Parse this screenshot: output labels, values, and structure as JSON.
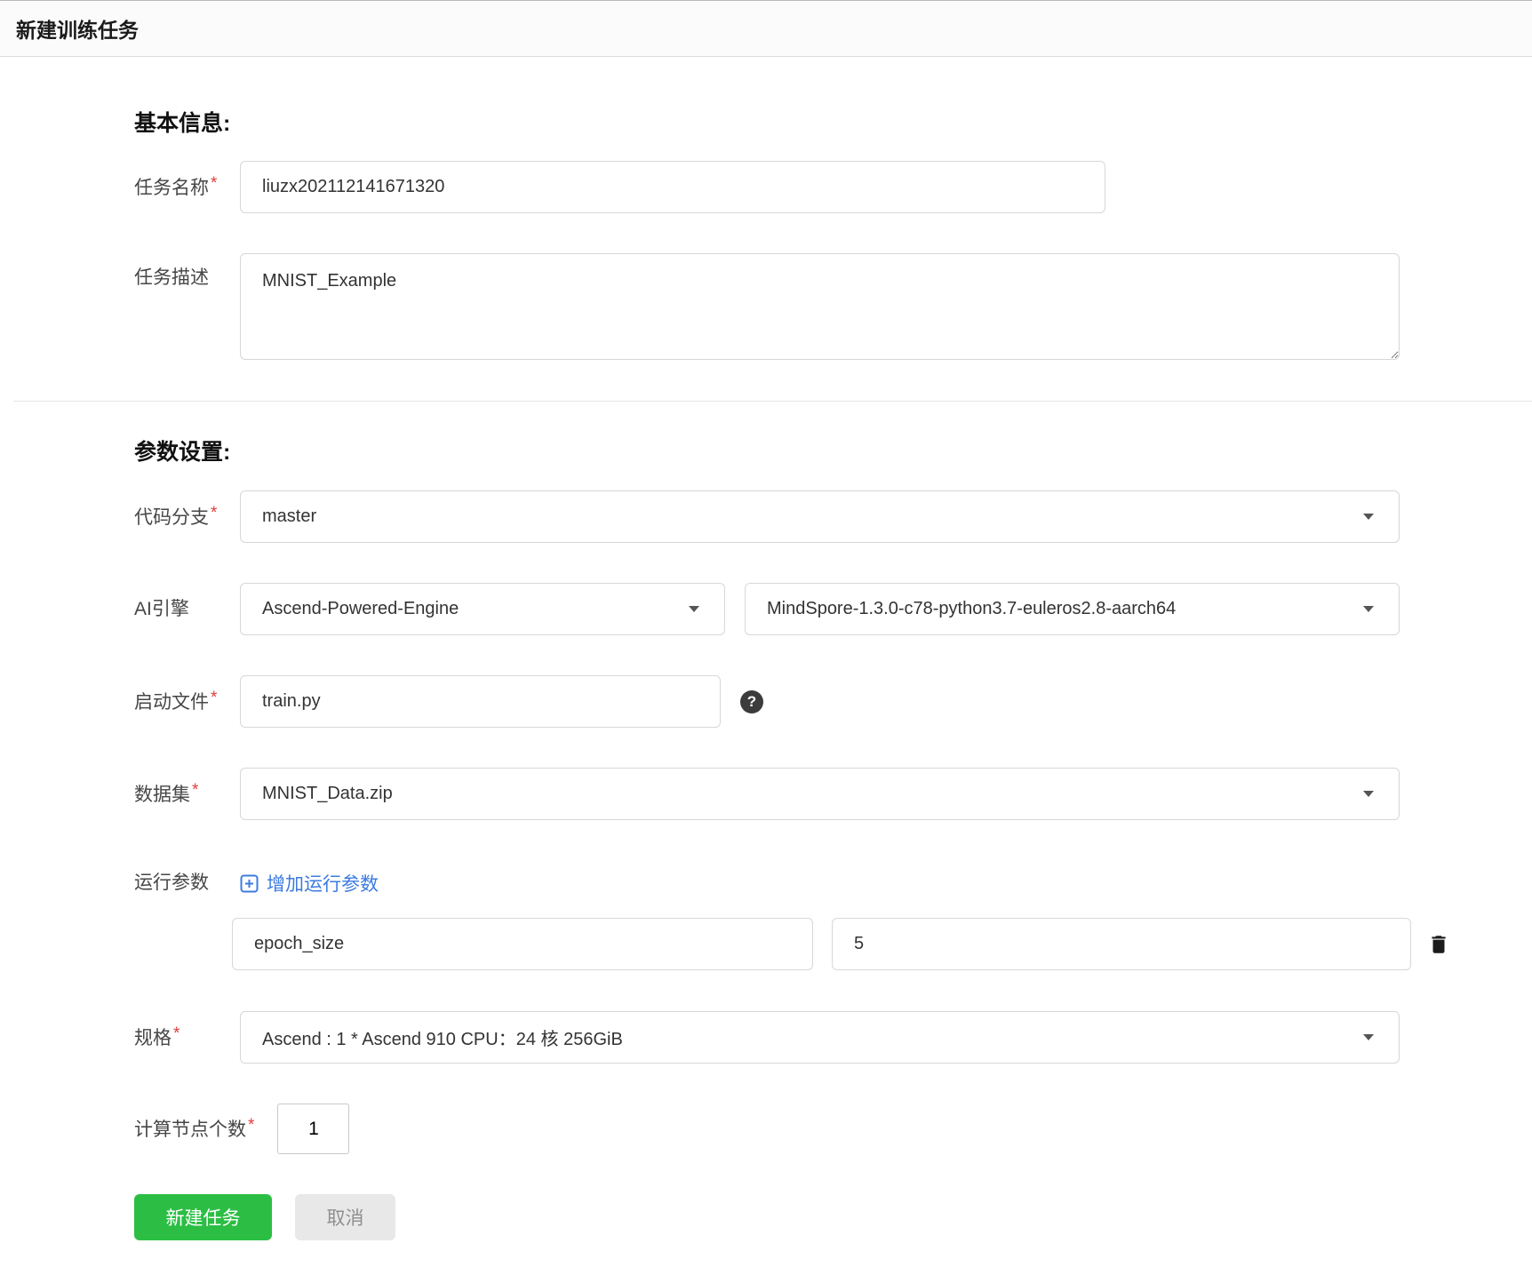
{
  "window": {
    "title": "新建训练任务"
  },
  "sections": {
    "basic_heading": "基本信息:",
    "params_heading": "参数设置:"
  },
  "required_marker": "*",
  "fields": {
    "task_name": {
      "label": "任务名称",
      "value": "liuzx202112141671320"
    },
    "task_desc": {
      "label": "任务描述",
      "value": "MNIST_Example"
    },
    "code_branch": {
      "label": "代码分支",
      "selected": "master"
    },
    "ai_engine": {
      "label": "AI引擎",
      "engine_selected": "Ascend-Powered-Engine",
      "version_selected": "MindSpore-1.3.0-c78-python3.7-euleros2.8-aarch64"
    },
    "boot_file": {
      "label": "启动文件",
      "value": "train.py"
    },
    "dataset": {
      "label": "数据集",
      "selected": "MNIST_Data.zip"
    },
    "run_params": {
      "label": "运行参数",
      "add_button_label": "增加运行参数",
      "entries": [
        {
          "name": "epoch_size",
          "value": "5"
        }
      ]
    },
    "spec": {
      "label": "规格",
      "selected": "Ascend : 1 * Ascend 910 CPU：24 核 256GiB"
    },
    "node_count": {
      "label": "计算节点个数",
      "value": "1"
    }
  },
  "actions": {
    "submit_label": "新建任务",
    "cancel_label": "取消"
  },
  "icons": {
    "help_glyph": "?"
  },
  "colors": {
    "primary_green": "#2cbe44",
    "link_blue": "#3c7be0",
    "required_red": "#e03c3c"
  }
}
